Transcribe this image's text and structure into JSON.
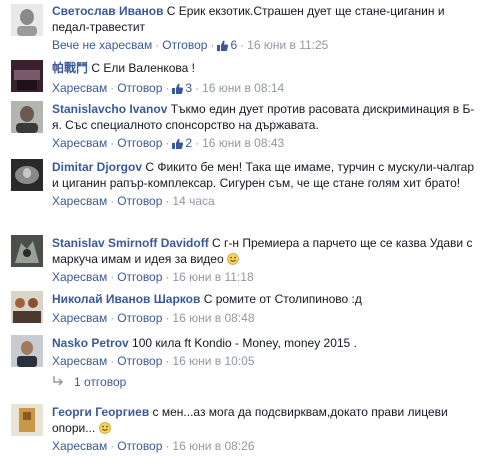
{
  "comments": [
    {
      "author": "Светослав Иванов",
      "text": " С Ерик екзотик.Страшен дует ще стане-циганин и педал-травестит",
      "like_label": "Вече не харесвам",
      "reply_label": "Отговор",
      "likes": "6",
      "time": "16 юни в 11:25",
      "avatar_icon": "avatar-photo-icon"
    },
    {
      "author": "帕戰鬥",
      "text": " С Ели Валенкова !",
      "like_label": "Харесвам",
      "reply_label": "Отговор",
      "likes": "3",
      "time": "16 юни в 08:14",
      "avatar_icon": "avatar-photo-icon"
    },
    {
      "author": "Stanislavcho Ivanov",
      "text": " Тъкмо един дует против расовата дискриминация в Б-я. Със специалното спонсорство на държавата.",
      "like_label": "Харесвам",
      "reply_label": "Отговор",
      "likes": "2",
      "time": "16 юни в 08:43",
      "avatar_icon": "avatar-photo-icon"
    },
    {
      "author": "Dimitar Djorgov",
      "text": " С Фикито бе мен! Така ще имаме, турчин с мускули-чалгар и циганин рапър-комплексар. Сигурен съм, че ще стане голям хит брато!",
      "like_label": "Харесвам",
      "reply_label": "Отговор",
      "time": "14 часа",
      "avatar_icon": "avatar-photo-icon"
    },
    {
      "author": "Stanislav Smirnoff Davidoff",
      "text": " С г-н Премиера а парчето ще се казва Удави с маркуча имам и идея за видео",
      "like_label": "Харесвам",
      "reply_label": "Отговор",
      "time": "16 юни в 11:18",
      "avatar_icon": "avatar-photo-icon"
    },
    {
      "author": "Николай Иванов Шарков",
      "text": " С ромите от Столипиново :д",
      "like_label": "Харесвам",
      "reply_label": "Отговор",
      "time": "16 юни в 08:48",
      "avatar_icon": "avatar-photo-icon"
    },
    {
      "author": "Nasko Petrov",
      "text": " 100 кила ft Kondio - Money, money 2015 .",
      "like_label": "Харесвам",
      "reply_label": "Отговор",
      "time": "16 юни в 10:05",
      "avatar_icon": "avatar-photo-icon"
    },
    {
      "author": "Георги Георгиев",
      "text": " с мен...аз мога да подсвирквам,докато прави лицеви опори...",
      "like_label": "Харесвам",
      "reply_label": "Отговор",
      "time": "16 юни в 08:26",
      "avatar_icon": "avatar-photo-icon"
    }
  ],
  "replies_link": "1 отговор",
  "colors": {
    "link": "#3b5998",
    "meta": "#9197a3",
    "text": "#141823"
  }
}
